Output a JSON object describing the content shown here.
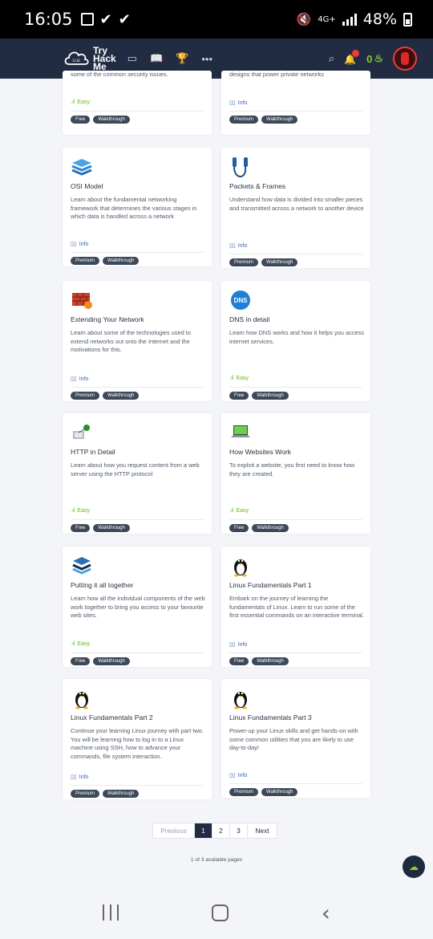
{
  "status_bar": {
    "time": "16:05",
    "network": "4G+",
    "battery": "48%"
  },
  "navbar": {
    "logo_text": "Try\nHack\nMe",
    "streak": "0"
  },
  "partial_cards": [
    {
      "meta": "Easy",
      "meta_type": "easy",
      "tags": [
        "Free",
        "Walkthrough"
      ]
    },
    {
      "meta": "Info",
      "meta_type": "info",
      "tags": [
        "Premium",
        "Walkthrough"
      ]
    }
  ],
  "cards": [
    {
      "title": "OSI Model",
      "desc": "Learn about the fundamental networking framework that determines the various stages in which data is handled across a network",
      "meta": "Info",
      "meta_type": "info",
      "tags": [
        "Premium",
        "Walkthrough"
      ],
      "icon": "stack-layers-icon"
    },
    {
      "title": "Packets & Frames",
      "desc": "Understand how data is divided into smaller pieces and transmitted across a network to another device",
      "meta": "Info",
      "meta_type": "info",
      "tags": [
        "Premium",
        "Walkthrough"
      ],
      "icon": "network-cable-icon"
    },
    {
      "title": "Extending Your Network",
      "desc": "Learn about some of the technologies used to extend networks out onto the Internet and the motivations for this.",
      "meta": "Info",
      "meta_type": "info",
      "tags": [
        "Premium",
        "Walkthrough"
      ],
      "icon": "firewall-icon"
    },
    {
      "title": "DNS in detail",
      "desc": "Learn how DNS works and how it helps you access internet services.",
      "meta": "Easy",
      "meta_type": "easy",
      "tags": [
        "Free",
        "Walkthrough"
      ],
      "icon": "dns-icon"
    },
    {
      "title": "HTTP in Detail",
      "desc": "Learn about how you request content from a web server using the HTTP protocol",
      "meta": "Easy",
      "meta_type": "easy",
      "tags": [
        "Free",
        "Walkthrough"
      ],
      "icon": "computer-network-icon"
    },
    {
      "title": "How Websites Work",
      "desc": "To exploit a website, you first need to know how they are created.",
      "meta": "Easy",
      "meta_type": "easy",
      "tags": [
        "Free",
        "Walkthrough"
      ],
      "icon": "laptop-icon"
    },
    {
      "title": "Putting it all together",
      "desc": "Learn how all the individual components of the web work together to bring you access to your favourite web sites.",
      "meta": "Easy",
      "meta_type": "easy",
      "tags": [
        "Free",
        "Walkthrough"
      ],
      "icon": "puzzle-layers-icon"
    },
    {
      "title": "Linux Fundamentals Part 1",
      "desc": "Embark on the journey of learning the fundamentals of Linux. Learn to run some of the first essential commands on an interactive terminal.",
      "meta": "Info",
      "meta_type": "info",
      "tags": [
        "Free",
        "Walkthrough"
      ],
      "icon": "linux-penguin-icon"
    },
    {
      "title": "Linux Fundamentals Part 2",
      "desc": "Continue your learning Linux journey with part two. You will be learning how to log in to a Linux machine using SSH, how to advance your commands, file system interaction.",
      "meta": "Info",
      "meta_type": "info",
      "tags": [
        "Premium",
        "Walkthrough"
      ],
      "icon": "linux-penguin-icon"
    },
    {
      "title": "Linux Fundamentals Part 3",
      "desc": "Power-up your Linux skills and get hands-on with some common utilities that you are likely to use day-to-day!",
      "meta": "Info",
      "meta_type": "info",
      "tags": [
        "Premium",
        "Walkthrough"
      ],
      "icon": "linux-penguin-icon"
    }
  ],
  "pagination": {
    "prev": "Previous",
    "pages": [
      "1",
      "2",
      "3"
    ],
    "next": "Next",
    "summary": "1 of 3 available pages"
  },
  "partial_top_texts": [
    "some of the common security issues.",
    "designs that power private networks"
  ]
}
